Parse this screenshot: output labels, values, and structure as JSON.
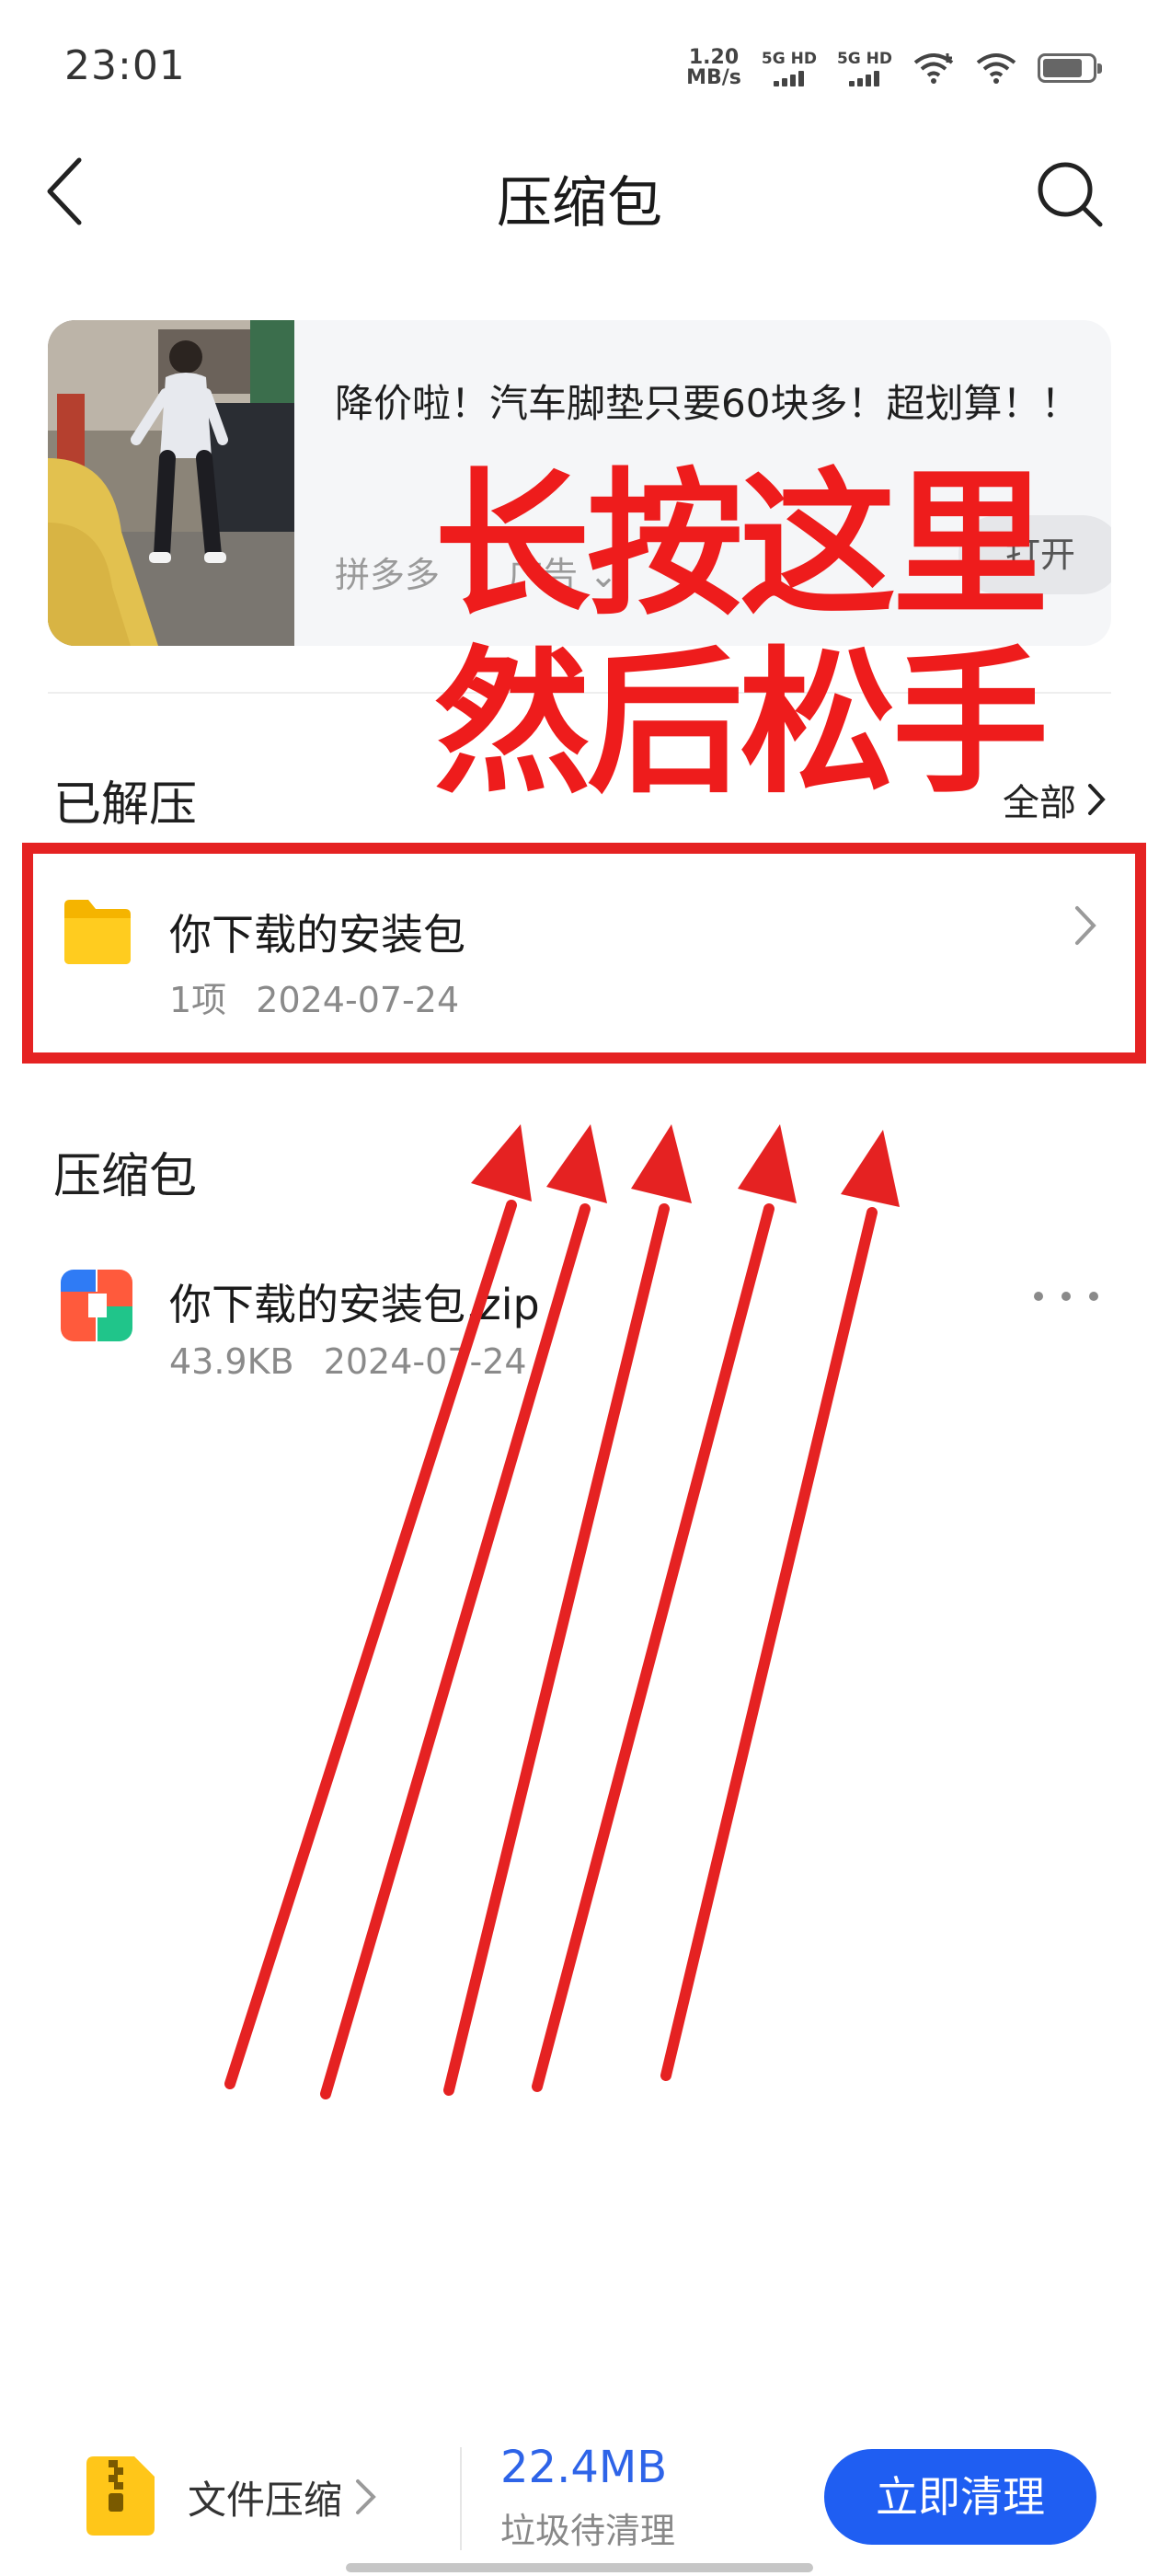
{
  "status_bar": {
    "time": "23:01",
    "net_speed_value": "1.20",
    "net_speed_unit": "MB/s",
    "sim1_label": "5G HD",
    "sim2_label": "5G HD",
    "battery_level": 0.8
  },
  "header": {
    "title": "压缩包",
    "back_icon": "chevron-left-icon",
    "search_icon": "search-icon"
  },
  "ad": {
    "title": "降价啦！汽车脚垫只要60块多！超划算！！",
    "source": "拼多多",
    "tag": "广告",
    "open_label": "打开"
  },
  "annotation": {
    "line1": "长按这里",
    "line2": "然后松手",
    "color": "#ee1c1c"
  },
  "extracted": {
    "section_title": "已解压",
    "see_all_label": "全部",
    "items": [
      {
        "name": "你下载的安装包",
        "count": "1项",
        "date": "2024-07-24",
        "icon": "folder-icon"
      }
    ]
  },
  "archives": {
    "section_title": "压缩包",
    "items": [
      {
        "name": "你下载的安装包.zip",
        "size": "43.9KB",
        "date": "2024-07-24",
        "icon": "zip-file-icon"
      }
    ]
  },
  "bottom_bar": {
    "compress_label": "文件压缩",
    "junk_size": "22.4MB",
    "junk_label": "垃圾待清理",
    "clean_button": "立即清理",
    "accent_color": "#1f5ef2"
  }
}
